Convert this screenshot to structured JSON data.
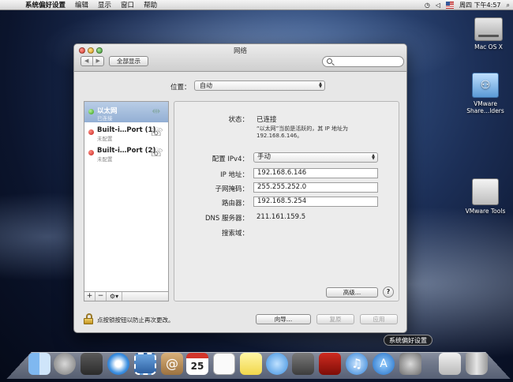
{
  "menubar": {
    "app": "系统偏好设置",
    "items": [
      "编辑",
      "显示",
      "窗口",
      "帮助"
    ],
    "clock": "周四 下午4:57"
  },
  "desktop": {
    "icons": [
      "Mac OS X",
      "VMware\nShare…lders",
      "VMware Tools"
    ]
  },
  "window": {
    "title": "网络",
    "show_all": "全部显示",
    "location_label": "位置：",
    "location_value": "自动",
    "services": [
      {
        "name": "以太网",
        "status": "已连接",
        "state": "connected"
      },
      {
        "name": "Built-i…Port (1)",
        "status": "未配置",
        "state": "off"
      },
      {
        "name": "Built-i…Port (2)",
        "status": "未配置",
        "state": "off"
      }
    ],
    "detail": {
      "status_label": "状态：",
      "status_value": "已连接",
      "status_note": "“以太网”当前是活跃的，其 IP 地址为 192.168.6.146。",
      "config_label": "配置 IPv4：",
      "config_value": "手动",
      "ip_label": "IP 地址：",
      "ip_value": "192.168.6.146",
      "mask_label": "子网掩码：",
      "mask_value": "255.255.252.0",
      "router_label": "路由器：",
      "router_value": "192.168.5.254",
      "dns_label": "DNS 服务器：",
      "dns_value": "211.161.159.5",
      "search_label": "搜索域：",
      "advanced": "高级…",
      "help": "?"
    },
    "lock_text": "点按锁按钮以防止再次更改。",
    "assist": "向导…",
    "revert": "复原",
    "apply": "应用"
  },
  "dock": {
    "tooltip": "系统偏好设置"
  },
  "colors": {
    "selection": "#93afd4",
    "status_connected": "#2f9a12",
    "status_off": "#c5201a"
  }
}
